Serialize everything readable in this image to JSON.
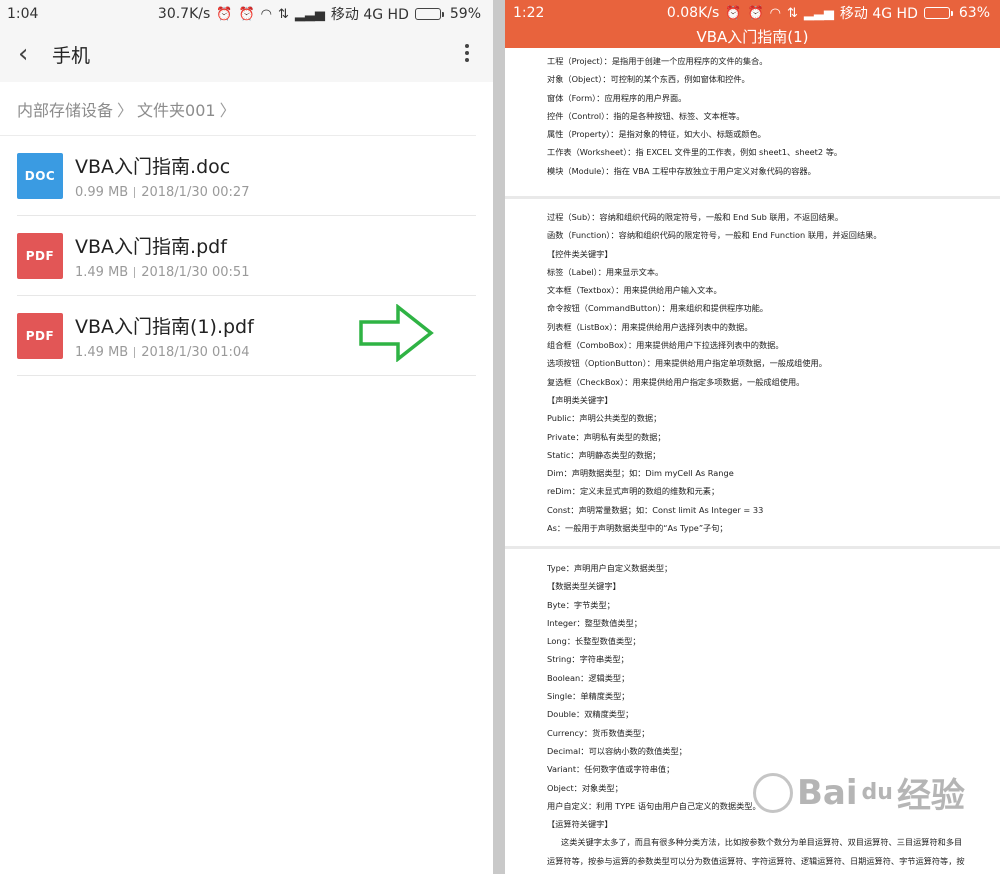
{
  "left": {
    "status": {
      "time": "1:04",
      "speed": "30.7K/s",
      "carrier": "移动 4G HD",
      "battery": "59%",
      "battery_level": 0.59
    },
    "appbar": {
      "title": "手机"
    },
    "breadcrumb": [
      "内部存储设备",
      "文件夹001"
    ],
    "files": [
      {
        "type": "DOC",
        "name": "VBA入门指南.doc",
        "size": "0.99 MB",
        "date": "2018/1/30 00:27"
      },
      {
        "type": "PDF",
        "name": "VBA入门指南.pdf",
        "size": "1.49 MB",
        "date": "2018/1/30 00:51"
      },
      {
        "type": "PDF",
        "name": "VBA入门指南(1).pdf",
        "size": "1.49 MB",
        "date": "2018/1/30 01:04"
      }
    ]
  },
  "right": {
    "status": {
      "time": "1:22",
      "speed": "0.08K/s",
      "carrier": "移动 4G HD",
      "battery": "63%",
      "battery_level": 0.63
    },
    "title": "VBA入门指南(1)",
    "page1": [
      "工程（Project）：是指用于创建一个应用程序的文件的集合。",
      "对象（Object）：可控制的某个东西，例如窗体和控件。",
      "窗体（Form）：应用程序的用户界面。",
      "控件（Control）：指的是各种按钮、标签、文本框等。",
      "属性（Property）：是指对象的特征，如大小、标题或颜色。",
      "工作表（Worksheet）：指 EXCEL 文件里的工作表，例如 sheet1、sheet2 等。",
      "模块（Module）：指在 VBA 工程中存放独立于用户定义对象代码的容器。"
    ],
    "page2": [
      "过程（Sub）：容纳和组织代码的限定符号，一般和 End Sub 联用，不返回结果。",
      "函数（Function）：容纳和组织代码的限定符号，一般和 End Function 联用，并返回结果。",
      "【控件类关键字】",
      "标签（Label）：用来显示文本。",
      "文本框（Textbox）：用来提供给用户输入文本。",
      "命令按钮（CommandButton）：用来组织和提供程序功能。",
      "列表框（ListBox）：用来提供给用户选择列表中的数据。",
      "组合框（ComboBox）：用来提供给用户下拉选择列表中的数据。",
      "选项按钮（OptionButton）：用来提供给用户指定单项数据，一般成组使用。",
      "复选框（CheckBox）：用来提供给用户指定多项数据，一般成组使用。",
      "【声明类关键字】",
      "Public：声明公共类型的数据；",
      "Private：声明私有类型的数据；",
      "Static：声明静态类型的数据；",
      "Dim：声明数据类型；如：Dim myCell As Range",
      "reDim：定义未显式声明的数组的维数和元素；",
      "Const：声明常量数据；如：Const limit As Integer = 33",
      "As：一般用于声明数据类型中的“As Type”子句；"
    ],
    "page3": [
      "Type：声明用户自定义数据类型；",
      "【数据类型关键字】",
      "Byte：字节类型；",
      "Integer：整型数值类型；",
      "Long：长整型数值类型；",
      "String：字符串类型；",
      "Boolean：逻辑类型；",
      "Single：单精度类型；",
      "Double：双精度类型；",
      "Currency：货币数值类型；",
      "Decimal：可以容纳小数的数值类型；",
      "Variant：任何数字值或字符串值；",
      "Object：对象类型；",
      "用户自定义：利用 TYPE 语句由用户自己定义的数据类型。",
      "【运算符关键字】",
      "这类关键字太多了，而且有很多种分类方法，比如按参数个数分为单目运算符、双目运算符、三目运算符和多目",
      "运算符等，按参与运算的参数类型可以分为数值运算符、字符运算符、逻辑运算符、日期运算符、字节运算符等，按"
    ]
  },
  "watermark": {
    "text": "Bai",
    "suffix": "du",
    "cn": "经验"
  }
}
